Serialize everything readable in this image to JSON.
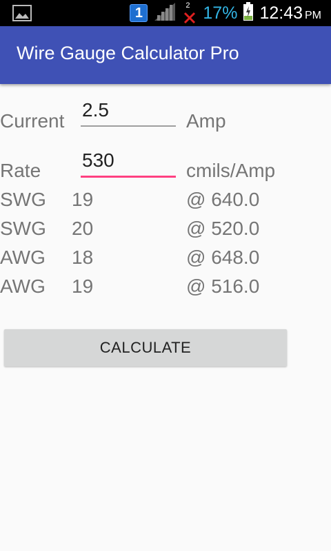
{
  "status_bar": {
    "sim_label": "1",
    "notification_count": "2",
    "battery_percent": "17%",
    "time": "12:43",
    "ampm": "PM"
  },
  "app": {
    "title": "Wire Gauge Calculator Pro"
  },
  "inputs": {
    "current": {
      "label": "Current",
      "value": "2.5",
      "unit": "Amp"
    },
    "rate": {
      "label": "Rate",
      "value": "530",
      "unit": "cmils/Amp"
    }
  },
  "results": [
    {
      "type": "SWG",
      "gauge": "19",
      "rating": "@ 640.0"
    },
    {
      "type": "SWG",
      "gauge": "20",
      "rating": "@ 520.0"
    },
    {
      "type": "AWG",
      "gauge": "18",
      "rating": "@ 648.0"
    },
    {
      "type": "AWG",
      "gauge": "19",
      "rating": "@ 516.0"
    }
  ],
  "calculate_button": {
    "label": "CALCULATE"
  },
  "colors": {
    "app_bar": "#3f51b5",
    "accent": "#ff4081",
    "battery_text": "#33b5e5"
  }
}
